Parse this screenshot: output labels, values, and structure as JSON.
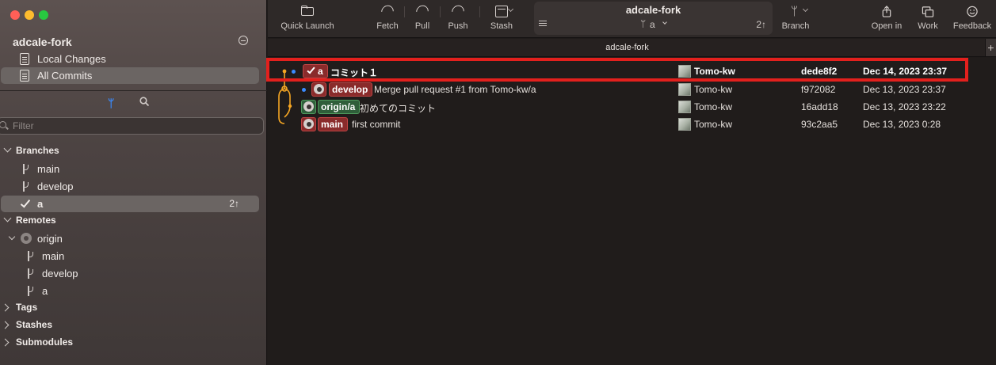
{
  "window": {
    "traffic_colors": [
      "#ff5f57",
      "#febc2e",
      "#28c840"
    ]
  },
  "sidebar": {
    "repo_name": "adcale-fork",
    "nav": [
      {
        "label": "Local Changes",
        "selected": false
      },
      {
        "label": "All Commits",
        "selected": true
      }
    ],
    "filter_placeholder": "Filter",
    "sections": {
      "branches": {
        "label": "Branches",
        "items": [
          {
            "label": "main"
          },
          {
            "label": "develop"
          },
          {
            "label": "a",
            "current": true,
            "ahead": "2↑"
          }
        ]
      },
      "remotes": {
        "label": "Remotes",
        "remote_name": "origin",
        "items": [
          {
            "label": "main"
          },
          {
            "label": "develop"
          },
          {
            "label": "a"
          }
        ]
      },
      "tags": {
        "label": "Tags"
      },
      "stashes": {
        "label": "Stashes"
      },
      "submodules": {
        "label": "Submodules"
      }
    }
  },
  "toolbar": {
    "quick_launch": "Quick Launch",
    "fetch": "Fetch",
    "pull": "Pull",
    "push": "Push",
    "stash": "Stash",
    "repo_name": "adcale-fork",
    "current_branch": "a",
    "ahead": "2↑",
    "branch": "Branch",
    "open_in": "Open in",
    "work": "Work",
    "feedback": "Feedback"
  },
  "tab": {
    "title": "adcale-fork",
    "add": "+"
  },
  "commits": [
    {
      "badges": [
        {
          "text": "a",
          "color": "red",
          "checked": true
        }
      ],
      "message": "コミット１",
      "author": "Tomo-kw",
      "sha": "dede8f2",
      "date": "Dec 14, 2023 23:37",
      "bold": true
    },
    {
      "badges": [
        {
          "text": "develop",
          "color": "red",
          "github": true
        }
      ],
      "message": "Merge pull request #1 from Tomo-kw/a",
      "author": "Tomo-kw",
      "sha": "f972082",
      "date": "Dec 13, 2023 23:37",
      "bold": false
    },
    {
      "badges": [
        {
          "text": "origin/a",
          "color": "green",
          "github": true
        }
      ],
      "message": "初めてのコミット",
      "author": "Tomo-kw",
      "sha": "16add18",
      "date": "Dec 13, 2023 23:22",
      "bold": false
    },
    {
      "badges": [
        {
          "text": "main",
          "color": "red",
          "github": true
        }
      ],
      "message": "first commit",
      "author": "Tomo-kw",
      "sha": "93c2aa5",
      "date": "Dec 13, 2023 0:28",
      "bold": false
    }
  ],
  "colors": {
    "accent": "#3a8bff",
    "graph": "#f5a623",
    "highlight": "#e3201d",
    "badge_red": "#8a2b2b",
    "badge_green": "#2f5e3a"
  }
}
